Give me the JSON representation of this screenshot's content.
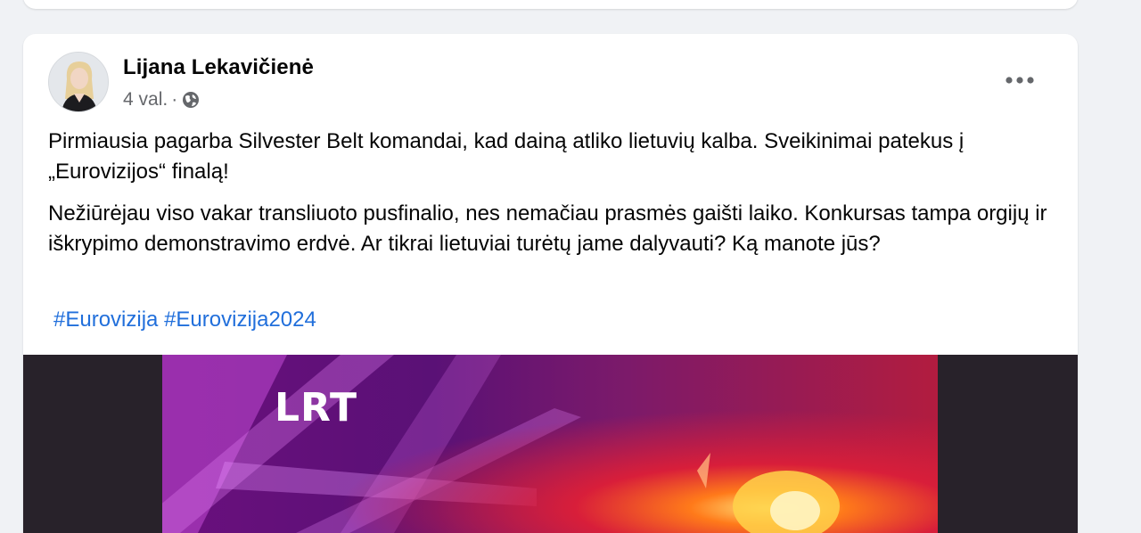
{
  "post": {
    "author": "Lijana Lekavičienė",
    "time": "4 val.",
    "separator": "·",
    "audience_icon": "globe-icon",
    "more_icon": "more-horizontal-icon",
    "paragraphs": [
      "Pirmiausia pagarba Silvester Belt komandai, kad dainą atliko lietuvių kalba. Sveikinimai patekus į „Eurovizijos“ finalą!",
      "Nežiūrėjau viso vakar transliuoto pusfinalio, nes nemačiau prasmės gaišti laiko. Konkursas tampa orgijų ir iškrypimo demonstravimo erdvė. Ar tikrai lietuviai turėtų jame dalyvauti? Ką manote jūs?"
    ],
    "hashtags": [
      "#Eurovizija",
      "#Eurovizija2024"
    ],
    "media": {
      "logo": "LRT"
    }
  },
  "colors": {
    "page_bg": "#f0f2f5",
    "card_bg": "#ffffff",
    "text": "#050505",
    "secondary_text": "#65676b",
    "link": "#216fdb",
    "media_bg": "#28222a"
  }
}
